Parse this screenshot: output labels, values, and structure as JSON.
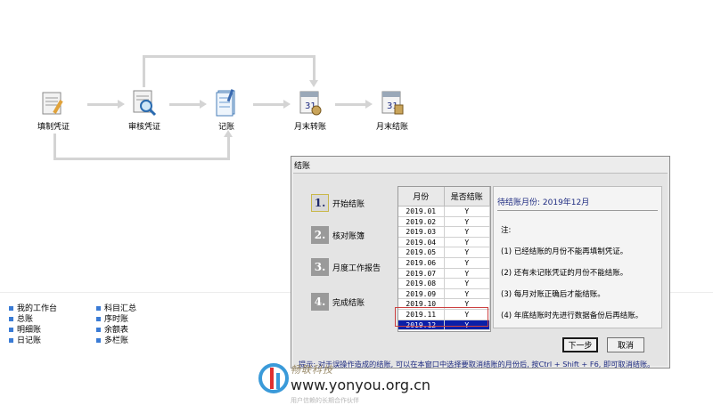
{
  "flow": {
    "nodes": [
      {
        "label": "填制凭证",
        "icon": "document-pen-icon"
      },
      {
        "label": "审核凭证",
        "icon": "document-magnifier-icon"
      },
      {
        "label": "记账",
        "icon": "ledger-book-icon"
      },
      {
        "label": "月末转账",
        "icon": "calendar-transfer-icon"
      },
      {
        "label": "月末结账",
        "icon": "calendar-close-icon"
      }
    ]
  },
  "nav": {
    "col1": [
      "我的工作台",
      "总账",
      "明细账",
      "日记账"
    ],
    "col2": [
      "科目汇总",
      "序时账",
      "余额表",
      "多栏账"
    ]
  },
  "dialog": {
    "title": "结账",
    "steps": [
      {
        "num": "1.",
        "label": "开始结账"
      },
      {
        "num": "2.",
        "label": "核对账簿"
      },
      {
        "num": "3.",
        "label": "月度工作报告"
      },
      {
        "num": "4.",
        "label": "完成结账"
      }
    ],
    "grid": {
      "headers": [
        "月份",
        "是否结账"
      ],
      "rows": [
        [
          "2019.01",
          "Y"
        ],
        [
          "2019.02",
          "Y"
        ],
        [
          "2019.03",
          "Y"
        ],
        [
          "2019.04",
          "Y"
        ],
        [
          "2019.05",
          "Y"
        ],
        [
          "2019.06",
          "Y"
        ],
        [
          "2019.07",
          "Y"
        ],
        [
          "2019.08",
          "Y"
        ],
        [
          "2019.09",
          "Y"
        ],
        [
          "2019.10",
          "Y"
        ],
        [
          "2019.11",
          "Y"
        ],
        [
          "2019.12",
          "Y"
        ]
      ],
      "selected_index": 11
    },
    "info": {
      "title": "待结账月份: 2019年12月",
      "note_label": "注:",
      "notes": [
        "(1) 已经结账的月份不能再填制凭证。",
        "(2) 还有未记账凭证的月份不能结账。",
        "(3) 每月对账正确后才能结账。",
        "(4) 年底结账时先进行数据备份后再结账。"
      ]
    },
    "buttons": {
      "next": "下一步",
      "cancel": "取消"
    },
    "tip": "提示: 对于误操作造成的结账, 可以在本窗口中选择要取消结账的月份后, 按Ctrl + Shift + F6, 即可取消结账。"
  },
  "watermark": {
    "brand": "畅联科技",
    "url": "www.yonyou.org.cn",
    "slogan": "用户信赖的长期合作伙伴"
  }
}
